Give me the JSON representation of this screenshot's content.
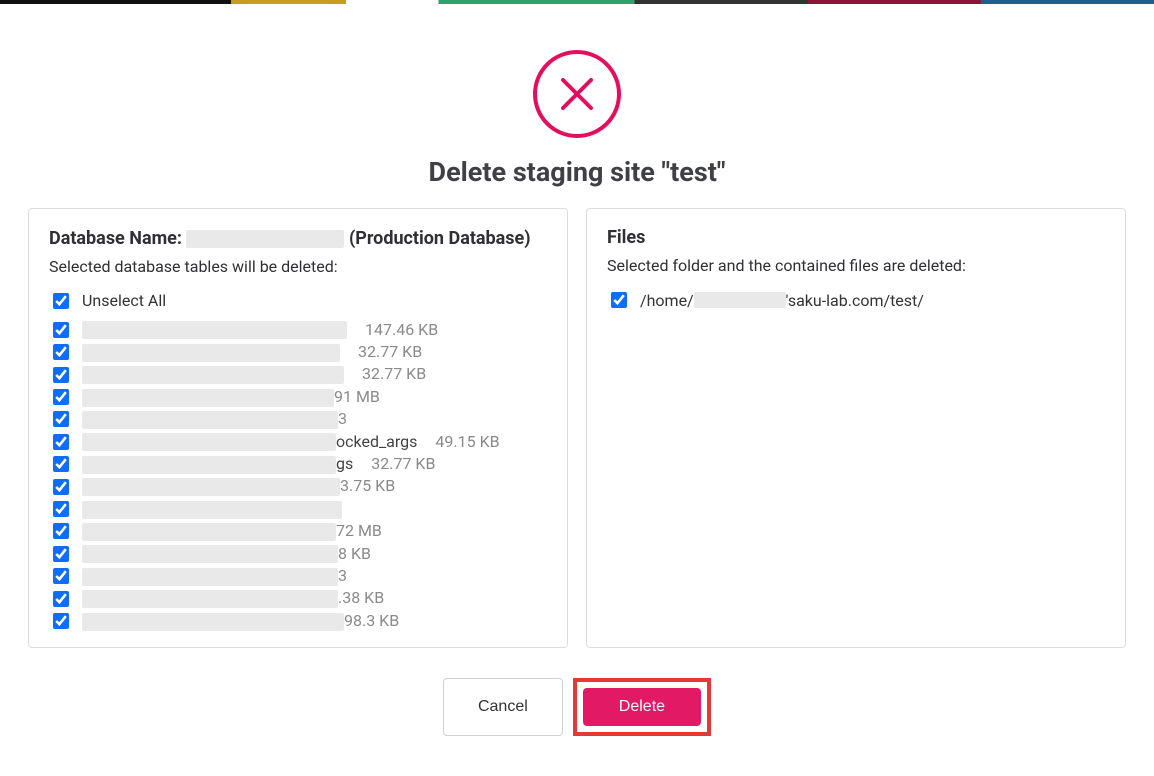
{
  "dialog": {
    "title": "Delete staging site \"test\""
  },
  "database": {
    "name_label": "Database Name:",
    "name_suffix": "(Production Database)",
    "sub_label": "Selected database tables will be deleted:",
    "unselect_all_label": "Unselect All",
    "tables": [
      {
        "mask_width": 265,
        "name_visible": "",
        "size": "147.46 KB",
        "checked": true
      },
      {
        "mask_width": 258,
        "name_visible": "",
        "size": "32.77 KB",
        "checked": true
      },
      {
        "mask_width": 262,
        "name_visible": "",
        "size": "32.77 KB",
        "checked": true
      },
      {
        "mask_width": 252,
        "name_visible": "91 MB",
        "size": "",
        "checked": true
      },
      {
        "mask_width": 256,
        "name_visible": "3",
        "size": "",
        "checked": true
      },
      {
        "mask_width": 254,
        "name_visible": "ocked_args",
        "size": "49.15 KB",
        "checked": true
      },
      {
        "mask_width": 254,
        "name_visible": "gs",
        "size": "32.77 KB",
        "checked": true
      },
      {
        "mask_width": 258,
        "name_visible": "3.75 KB",
        "size": "",
        "checked": true
      },
      {
        "mask_width": 260,
        "name_visible": "",
        "size": "",
        "checked": true
      },
      {
        "mask_width": 254,
        "name_visible": "72 MB",
        "size": "",
        "checked": true
      },
      {
        "mask_width": 256,
        "name_visible": "8 KB",
        "size": "",
        "checked": true
      },
      {
        "mask_width": 256,
        "name_visible": "3",
        "size": "",
        "checked": true
      },
      {
        "mask_width": 256,
        "name_visible": ".38 KB",
        "size": "",
        "checked": true
      },
      {
        "mask_width": 262,
        "name_visible": "98.3 KB",
        "size": "",
        "checked": true
      }
    ]
  },
  "files": {
    "title": "Files",
    "sub_label": "Selected folder and the contained files are deleted:",
    "path_prefix": "/home/",
    "path_suffix": "'saku-lab.com/test/",
    "checked": true
  },
  "actions": {
    "cancel_label": "Cancel",
    "delete_label": "Delete"
  }
}
